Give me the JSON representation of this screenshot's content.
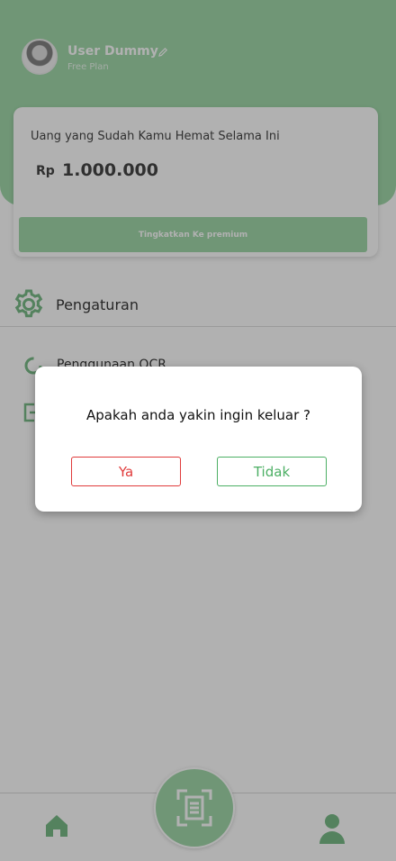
{
  "colors": {
    "primary": "#8fd19a",
    "danger": "#e03b3b",
    "success": "#4caf64",
    "overlay": "rgba(70,70,70,0.42)"
  },
  "profile": {
    "name": "User Dummy",
    "plan": "Free Plan"
  },
  "savings_card": {
    "title": "Uang yang Sudah Kamu Hemat Selama Ini",
    "currency": "Rp",
    "amount": "1.000.000",
    "upgrade_label": "Tingkatkan Ke premium"
  },
  "menu": {
    "settings_label": "Pengaturan",
    "items": [
      {
        "label": "Penggunaan OCR",
        "icon": "circle-progress-icon"
      },
      {
        "label": "",
        "icon": "logout-icon"
      }
    ]
  },
  "dialog": {
    "message": "Apakah anda yakin ingin keluar ?",
    "yes_label": "Ya",
    "no_label": "Tidak"
  },
  "bottom_nav": {
    "items": [
      {
        "icon": "home-icon"
      },
      {
        "icon": "scan-document-icon"
      },
      {
        "icon": "profile-icon"
      }
    ]
  }
}
